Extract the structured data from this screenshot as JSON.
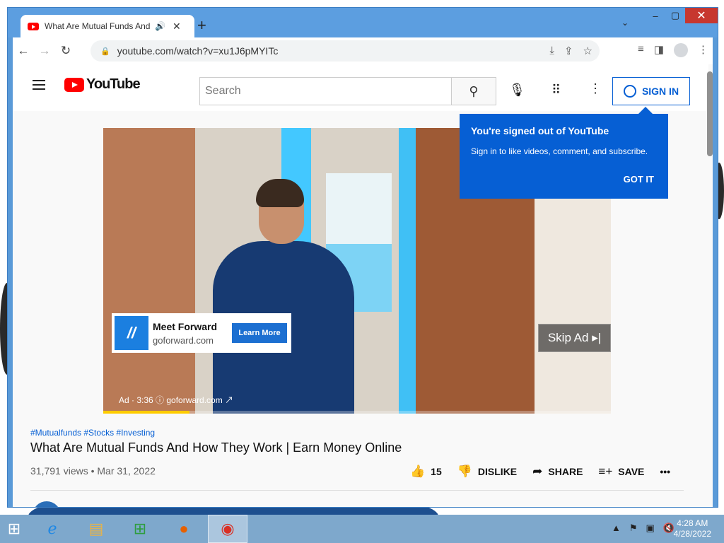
{
  "browser": {
    "tab_title": "What Are Mutual Funds And",
    "tab_speaker_icon": "🔊",
    "tab_close": "✕",
    "new_tab": "+",
    "tab_search": "⌄",
    "window_minimize": "‒",
    "window_maximize": "▢",
    "window_close": "✕",
    "url": "youtube.com/watch?v=xu1J6pMYITc"
  },
  "youtube": {
    "logo_text": "YouTube",
    "search_placeholder": "Search",
    "sign_in_label": "SIGN IN",
    "popup": {
      "title": "You're signed out of YouTube",
      "body": "Sign in to like videos, comment, and subscribe.",
      "button": "GOT IT"
    },
    "ad": {
      "name": "Meet Forward",
      "domain": "goforward.com",
      "logo": "//",
      "cta": "Learn More",
      "skip": "Skip Ad ▸|",
      "meta": "Ad · 3:36 ⓘ  goforward.com ↗",
      "progress_fraction": 0.17
    },
    "video": {
      "hashtags": "#Mutualfunds #Stocks #Investing",
      "title": "What Are Mutual Funds And How They Work | Earn Money Online",
      "views": "31,791 views • Mar 31, 2022",
      "likes": "15",
      "dislike_label": "DISLIKE",
      "share_label": "SHARE",
      "save_label": "SAVE",
      "more": "•••"
    }
  },
  "taskbar": {
    "time": "4:28 AM",
    "date": "4/28/2022"
  },
  "colors": {
    "accent": "#065fd4",
    "youtube_red": "#ff0000",
    "window_frame": "#5c9ee0"
  }
}
